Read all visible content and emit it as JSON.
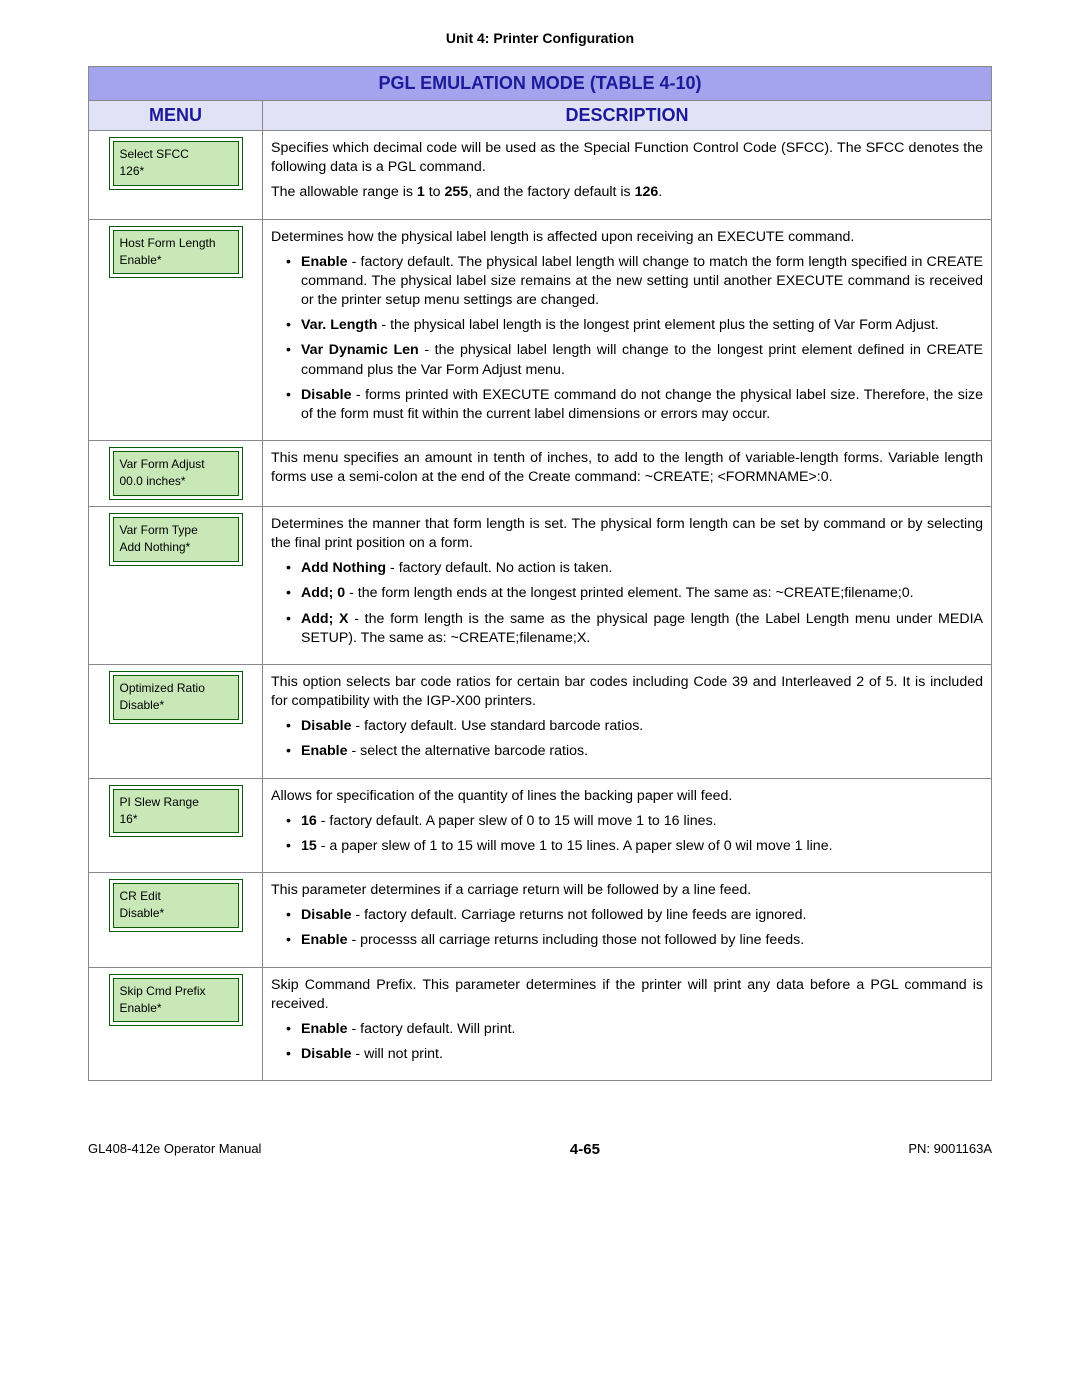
{
  "page_header": "Unit 4:  Printer Configuration",
  "table_title": "PGL EMULATION MODE (TABLE 4-10)",
  "col_menu": "MENU",
  "col_desc": "DESCRIPTION",
  "rows": [
    {
      "menu_name": "Select SFCC",
      "menu_value": "126*",
      "desc_intro": "Specifies which decimal code will be used as the Special Function Control Code (SFCC). The SFCC denotes the following data is a PGL command.",
      "desc_extra_html": "The allowable range is <b>1</b> to <b>255</b>, and the factory default is <b>126</b>.",
      "bullets": []
    },
    {
      "menu_name": "Host Form Length",
      "menu_value": "Enable*",
      "desc_intro": "Determines how the physical label length is affected upon receiving an EXECUTE command.",
      "bullets": [
        "<b>Enable</b> - factory default. The physical label length will change to match the form length specified in CREATE command. The physical label size remains at the new setting until another EXECUTE command is received or the printer setup menu settings are changed.",
        "<b>Var. Length</b> - the physical label length is the longest print element plus the setting of Var Form Adjust.",
        "<b>Var Dynamic Len</b> - the physical label length will change to the longest print element defined in CREATE command plus the Var Form Adjust menu.",
        "<b>Disable</b> - forms printed with EXECUTE command do not change the physical label size. Therefore, the size of the form must fit within the current label dimensions or errors may occur."
      ]
    },
    {
      "menu_name": "Var Form Adjust",
      "menu_value": "00.0  inches*",
      "desc_intro": "This menu specifies an amount in tenth of inches, to add to the length of variable-length forms. Variable length forms use a semi-colon at the end of the Create command: ~CREATE; <FORMNAME>:0.",
      "bullets": []
    },
    {
      "menu_name": "Var Form Type",
      "menu_value": "Add Nothing*",
      "desc_intro": "Determines the manner that form length is set. The physical form length can be set by command or by selecting the final print position on a form.",
      "bullets": [
        "<b>Add Nothing</b> - factory default. No action is taken.",
        "<b>Add; 0</b> - the form length ends at the longest printed element. The same as: ~CREATE;filename;0.",
        "<b>Add; X</b> - the form length is the same as the physical page length (the Label Length menu under MEDIA SETUP). The same as: ~CREATE;filename;X."
      ]
    },
    {
      "menu_name": "Optimized Ratio",
      "menu_value": "Disable*",
      "desc_intro": "This option selects bar code ratios for certain bar codes including Code 39 and Interleaved 2 of 5. It is included for compatibility with the IGP-X00 printers.",
      "bullets": [
        "<b>Disable</b> - factory default. Use standard barcode ratios.",
        "<b>Enable</b> - select the alternative barcode ratios."
      ]
    },
    {
      "menu_name": "PI Slew Range",
      "menu_value": "16*",
      "desc_intro": "Allows for specification of the quantity of lines the backing paper will feed.",
      "bullets": [
        "<b>16</b> - factory default. A paper slew of 0 to 15 will move 1 to 16 lines.",
        "<b>15</b> - a paper slew of 1 to 15 will move 1 to 15 lines. A paper slew of 0 wil move 1 line."
      ]
    },
    {
      "menu_name": "CR Edit",
      "menu_value": "Disable*",
      "desc_intro": "This parameter determines if a carriage return will be followed by a line feed.",
      "bullets": [
        "<b>Disable</b> - factory default. Carriage returns not followed by line feeds are ignored.",
        "<b>Enable</b> - processs all carriage returns including those not followed by line feeds."
      ]
    },
    {
      "menu_name": "Skip Cmd Prefix",
      "menu_value": "Enable*",
      "desc_intro": "Skip Command Prefix. This parameter determines if the printer will print any data before a PGL command is received.",
      "bullets": [
        "<b>Enable</b> - factory default. Will print.",
        "<b>Disable</b> - will not print."
      ]
    }
  ],
  "footer_left": "GL408-412e Operator Manual",
  "footer_center": "4-65",
  "footer_right": "PN: 9001163A"
}
